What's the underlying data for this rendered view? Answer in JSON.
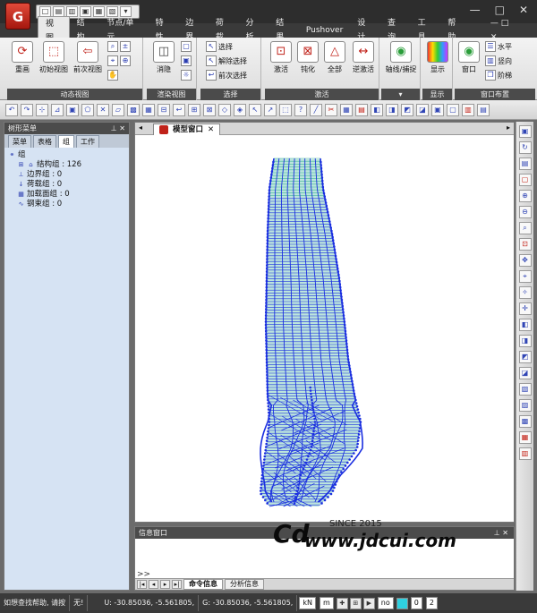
{
  "qat": [
    "□",
    "▤",
    "▥",
    "▣",
    "▦",
    "▧",
    "▾"
  ],
  "window_controls": [
    "—",
    "□",
    "✕"
  ],
  "menu": {
    "tabs": [
      "视图",
      "结构",
      "节点/单元",
      "特性",
      "边界",
      "荷载",
      "分析",
      "结果",
      "Pushover",
      "设计",
      "查询",
      "工具"
    ],
    "help": "帮助"
  },
  "ribbon": {
    "dynamic_view": {
      "buttons": [
        "重画",
        "初始视图",
        "前次视图"
      ],
      "caption": "动态视图"
    },
    "render_view": {
      "button": "消隐",
      "caption": "渲染视图"
    },
    "select": {
      "items": [
        "选择",
        "解除选择",
        "前次选择"
      ],
      "caption": "选择"
    },
    "activate": {
      "buttons": [
        "激活",
        "钝化",
        "全部",
        "逆激活"
      ],
      "caption": "激活"
    },
    "axis": {
      "button": "轴线/捕捉"
    },
    "display": {
      "button": "显示",
      "caption": "显示"
    },
    "window_layout": {
      "button": "窗口",
      "items": [
        "水平",
        "竖向",
        "阶梯"
      ],
      "caption": "窗口布置"
    }
  },
  "left_panel": {
    "title": "树形菜单",
    "tabs": [
      "菜单",
      "表格",
      "组",
      "工作"
    ],
    "active_tab": "组",
    "root": "组",
    "items": [
      "结构组 : 126",
      "边界组 : 0",
      "荷载组 : 0",
      "加载面组 : 0",
      "钢束组 : 0"
    ]
  },
  "model_window": {
    "tab_label": "模型窗口"
  },
  "info_window": {
    "title": "信息窗口",
    "prompt": ">>",
    "tabs": [
      "命令信息",
      "分析信息"
    ]
  },
  "watermark": {
    "since": "SINCE 2015",
    "url": "www.jdcui.com",
    "logo": "Cd"
  },
  "status": {
    "help": "如想查找帮助, 请按",
    "none": "无!",
    "coords": "U: -30.85036, -5.561805,",
    "global": "G: -30.85036, -5.561805,",
    "force_unit": "kN",
    "length_unit": "m",
    "option": "no",
    "page_current": "0",
    "page_total": "2"
  },
  "colors": {
    "frame": "#1a2ee0",
    "shell": "#3fb59a",
    "ribbon_caption": "#4b4b4b"
  }
}
